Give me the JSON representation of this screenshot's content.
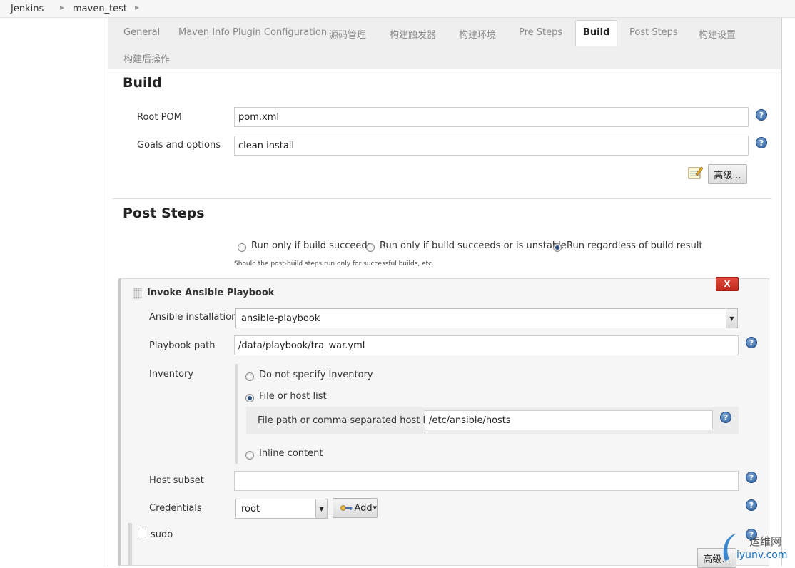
{
  "breadcrumb": {
    "items": [
      "Jenkins",
      "maven_test"
    ]
  },
  "tabs": [
    {
      "label": "General"
    },
    {
      "label": "Maven Info Plugin Configuration"
    },
    {
      "label": "源码管理"
    },
    {
      "label": "构建触发器"
    },
    {
      "label": "构建环境"
    },
    {
      "label": "Pre Steps"
    },
    {
      "label": "Build",
      "active": true
    },
    {
      "label": "Post Steps"
    },
    {
      "label": "构建设置"
    },
    {
      "label": "构建后操作"
    }
  ],
  "build": {
    "title": "Build",
    "root_pom_label": "Root POM",
    "root_pom_value": "pom.xml",
    "goals_label": "Goals and options",
    "goals_value": "clean install",
    "advanced_label": "高级..."
  },
  "post_steps": {
    "title": "Post Steps",
    "options": [
      {
        "label": "Run only if build succeeds",
        "checked": false
      },
      {
        "label": "Run only if build succeeds or is unstable",
        "checked": false
      },
      {
        "label": "Run regardless of build result",
        "checked": true
      }
    ],
    "hint": "Should the post-build steps run only for successful builds, etc."
  },
  "ansible": {
    "title": "Invoke Ansible Playbook",
    "delete_label": "X",
    "installation_label": "Ansible installation",
    "installation_value": "ansible-playbook",
    "playbook_label": "Playbook path",
    "playbook_value": "/data/playbook/tra_war.yml",
    "inventory_label": "Inventory",
    "inventory_options": [
      {
        "label": "Do not specify Inventory",
        "checked": false
      },
      {
        "label": "File or host list",
        "checked": true
      },
      {
        "label": "Inline content",
        "checked": false
      }
    ],
    "hostlist_label": "File path or comma separated host list",
    "hostlist_value": "/etc/ansible/hosts",
    "host_subset_label": "Host subset",
    "host_subset_value": "",
    "credentials_label": "Credentials",
    "credentials_value": "root",
    "add_label": "Add",
    "sudo_label": "sudo",
    "advanced_label": "高级..."
  },
  "watermark": {
    "text_cn": "运维网",
    "text_url": "iyunv.com"
  },
  "icons": {
    "help": "help-icon",
    "notepad": "notepad-icon",
    "key": "key-icon"
  },
  "colors": {
    "help_blue": "#2c5f9e",
    "delete_red": "#c0281c",
    "watermark_blue": "#1a73c9"
  }
}
